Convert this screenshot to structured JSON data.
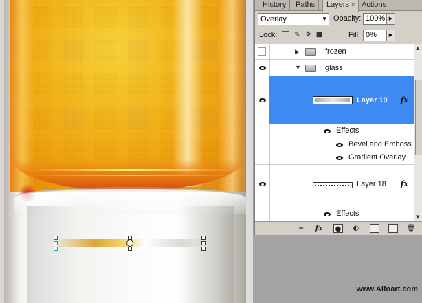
{
  "panel": {
    "tabs": [
      {
        "label": "History",
        "active": false
      },
      {
        "label": "Paths",
        "active": false
      },
      {
        "label": "Layers",
        "active": true
      },
      {
        "label": "Actions",
        "active": false
      }
    ],
    "close_glyph": "×",
    "blend_mode": "Overlay",
    "opacity_label": "Opacity:",
    "opacity_value": "100%",
    "lock_label": "Lock:",
    "fill_label": "Fill:",
    "fill_value": "0%"
  },
  "layers": {
    "rows": [
      {
        "name": "frozen",
        "kind": "group",
        "visible": false,
        "expanded": false
      },
      {
        "name": "glass",
        "kind": "group",
        "visible": true,
        "expanded": true
      },
      {
        "name": "Layer 19",
        "kind": "layer",
        "visible": true,
        "selected": true,
        "fx": "fx"
      },
      {
        "name": "Effects",
        "kind": "effects-header"
      },
      {
        "name": "Bevel and Emboss",
        "kind": "effect"
      },
      {
        "name": "Gradient Overlay",
        "kind": "effect"
      },
      {
        "name": "Layer 18",
        "kind": "layer",
        "visible": true,
        "selected": false,
        "fx": "fx"
      },
      {
        "name": "Effects",
        "kind": "effects-header"
      }
    ]
  },
  "bottombar": {
    "icons": [
      "link-icon",
      "fx-icon",
      "layer-mask-icon",
      "adjustment-layer-icon",
      "new-group-icon",
      "new-layer-icon",
      "trash-icon"
    ]
  },
  "watermark": "www.Alfoart.com",
  "colors": {
    "selected_layer": "#3d8af2",
    "panel_bg": "#d4d0c8",
    "liquid": "#f2b31a"
  }
}
